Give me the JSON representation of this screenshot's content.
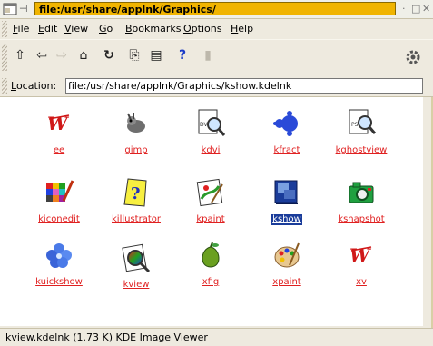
{
  "window": {
    "title": "file:/usr/share/applnk/Graphics/",
    "pin_glyph": "⊣",
    "controls": {
      "minimize": "·",
      "maximize": "□",
      "close": "✕"
    }
  },
  "menu": {
    "items": [
      "File",
      "Edit",
      "View",
      "Go",
      "Bookmarks",
      "Options",
      "Help"
    ]
  },
  "toolbar": {
    "tools": [
      {
        "name": "up-arrow-icon",
        "glyph": "⇧",
        "enabled": true
      },
      {
        "name": "back-arrow-icon",
        "glyph": "⇦",
        "enabled": true
      },
      {
        "name": "forward-arrow-icon",
        "glyph": "⇨",
        "enabled": false
      },
      {
        "name": "home-icon",
        "glyph": "⌂",
        "enabled": true
      },
      {
        "name": "reload-icon",
        "glyph": "↻",
        "enabled": true
      },
      {
        "name": "copy-icon",
        "glyph": "⎘",
        "enabled": true
      },
      {
        "name": "paste-icon",
        "glyph": "▤",
        "enabled": true
      },
      {
        "name": "help-icon",
        "glyph": "?",
        "enabled": true
      },
      {
        "name": "stop-icon",
        "glyph": "▮",
        "enabled": false
      }
    ]
  },
  "location": {
    "label": "Location:",
    "value": "file:/usr/share/applnk/Graphics/kshow.kdelnk"
  },
  "icons": [
    {
      "label": "ee",
      "icon": "ee-icon",
      "selected": false
    },
    {
      "label": "gimp",
      "icon": "gimp-icon",
      "selected": false
    },
    {
      "label": "kdvi",
      "icon": "kdvi-icon",
      "selected": false
    },
    {
      "label": "kfract",
      "icon": "kfract-icon",
      "selected": false
    },
    {
      "label": "kghostview",
      "icon": "kghostview-icon",
      "selected": false
    },
    {
      "label": "kiconedit",
      "icon": "kiconedit-icon",
      "selected": false
    },
    {
      "label": "killustrator",
      "icon": "killustrator-icon",
      "selected": false
    },
    {
      "label": "kpaint",
      "icon": "kpaint-icon",
      "selected": false
    },
    {
      "label": "kshow",
      "icon": "kshow-icon",
      "selected": true
    },
    {
      "label": "ksnapshot",
      "icon": "ksnapshot-icon",
      "selected": false
    },
    {
      "label": "kuickshow",
      "icon": "kuickshow-icon",
      "selected": false
    },
    {
      "label": "kview",
      "icon": "kview-icon",
      "selected": false
    },
    {
      "label": "xfig",
      "icon": "xfig-icon",
      "selected": false
    },
    {
      "label": "xpaint",
      "icon": "xpaint-icon",
      "selected": false
    },
    {
      "label": "xv",
      "icon": "xv-icon",
      "selected": false
    }
  ],
  "status": {
    "text": "kview.kdelnk (1.73 K)  KDE Image Viewer"
  },
  "colors": {
    "title_highlight": "#f0b400",
    "link": "#e02020",
    "selection": "#1a3c9a"
  }
}
